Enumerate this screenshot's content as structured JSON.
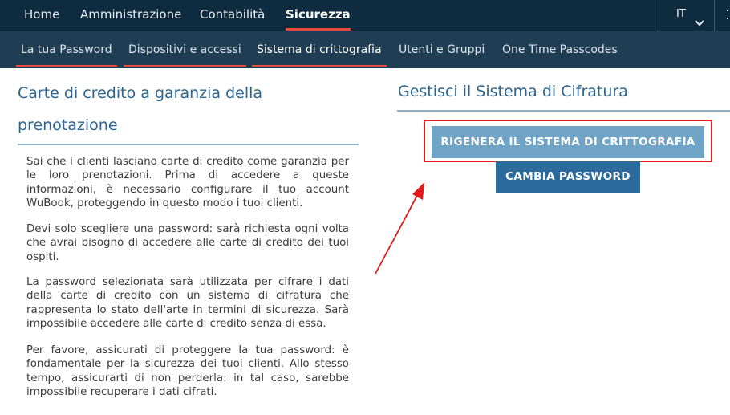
{
  "top_nav": {
    "items": [
      "Home",
      "Amministrazione",
      "Contabilità",
      "Sicurezza"
    ],
    "active": "Sicurezza",
    "language": "IT"
  },
  "sub_nav": {
    "items": [
      "La tua Password",
      "Dispositivi e accessi",
      "Sistema di crittografia",
      "Utenti e Gruppi",
      "One Time Passcodes"
    ],
    "active": "Sistema di crittografia"
  },
  "left": {
    "title": "Carte di credito a garanzia della prenotazione",
    "paragraphs": [
      "Sai che i clienti lasciano carte di credito come garanzia per le loro prenotazioni. Prima di accedere a queste informazioni, è necessario configurare il tuo account WuBook, proteggendo in questo modo i tuoi clienti.",
      "Devi solo scegliere una password: sarà richiesta ogni volta che avrai bisogno di accedere alle carte di credito dei tuoi ospiti.",
      "La password selezionata sarà utilizzata per cifrare i dati della carte di credito con un sistema di cifratura che rappresenta lo stato dell'arte in termini di sicurezza. Sarà impossibile accedere alle carte di credito senza di essa.",
      "Per favore, assicurati di proteggere la tua password: è fondamentale per la sicurezza dei tuoi clienti. Allo stesso tempo, assicurarti di non perderla: in tal caso, sarebbe impossibile recuperare i dati cifrati."
    ]
  },
  "right": {
    "title": "Gestisci il Sistema di Cifratura",
    "regen_button": "RIGENERA IL SISTEMA DI CRITTOGRAFIA",
    "password_button": "CAMBIA PASSWORD"
  },
  "colors": {
    "top_nav_bg": "#0f2b40",
    "sub_nav_bg": "#1f3e54",
    "accent": "#e84b3a",
    "heading": "#2a6590",
    "annotation": "#e01b1b"
  }
}
